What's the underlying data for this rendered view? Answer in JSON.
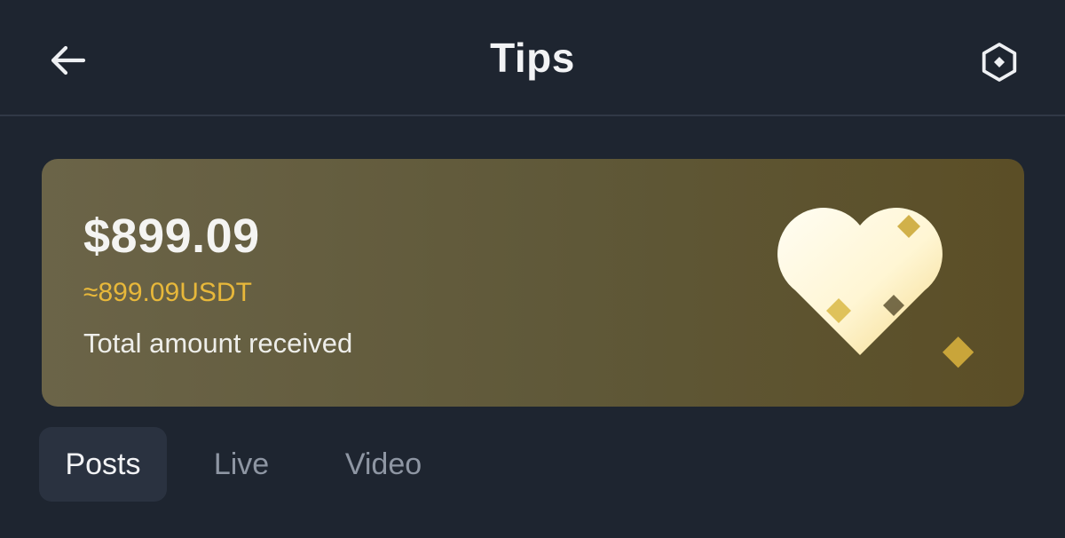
{
  "header": {
    "title": "Tips",
    "back_icon": "arrow-left-icon",
    "settings_icon": "hexagon-diamond-icon"
  },
  "card": {
    "amount": "$899.09",
    "usdt": "≈899.09USDT",
    "caption": "Total amount received",
    "art_icon": "heart-icon"
  },
  "tabs": [
    {
      "label": "Posts",
      "active": true
    },
    {
      "label": "Live",
      "active": false
    },
    {
      "label": "Video",
      "active": false
    }
  ],
  "colors": {
    "background": "#1e2530",
    "accent_gold": "#e8b83a",
    "card_start": "#6b6448",
    "card_end": "#5b4e26",
    "tab_active_bg": "#2a3240",
    "tab_inactive_text": "#8e96a3"
  }
}
